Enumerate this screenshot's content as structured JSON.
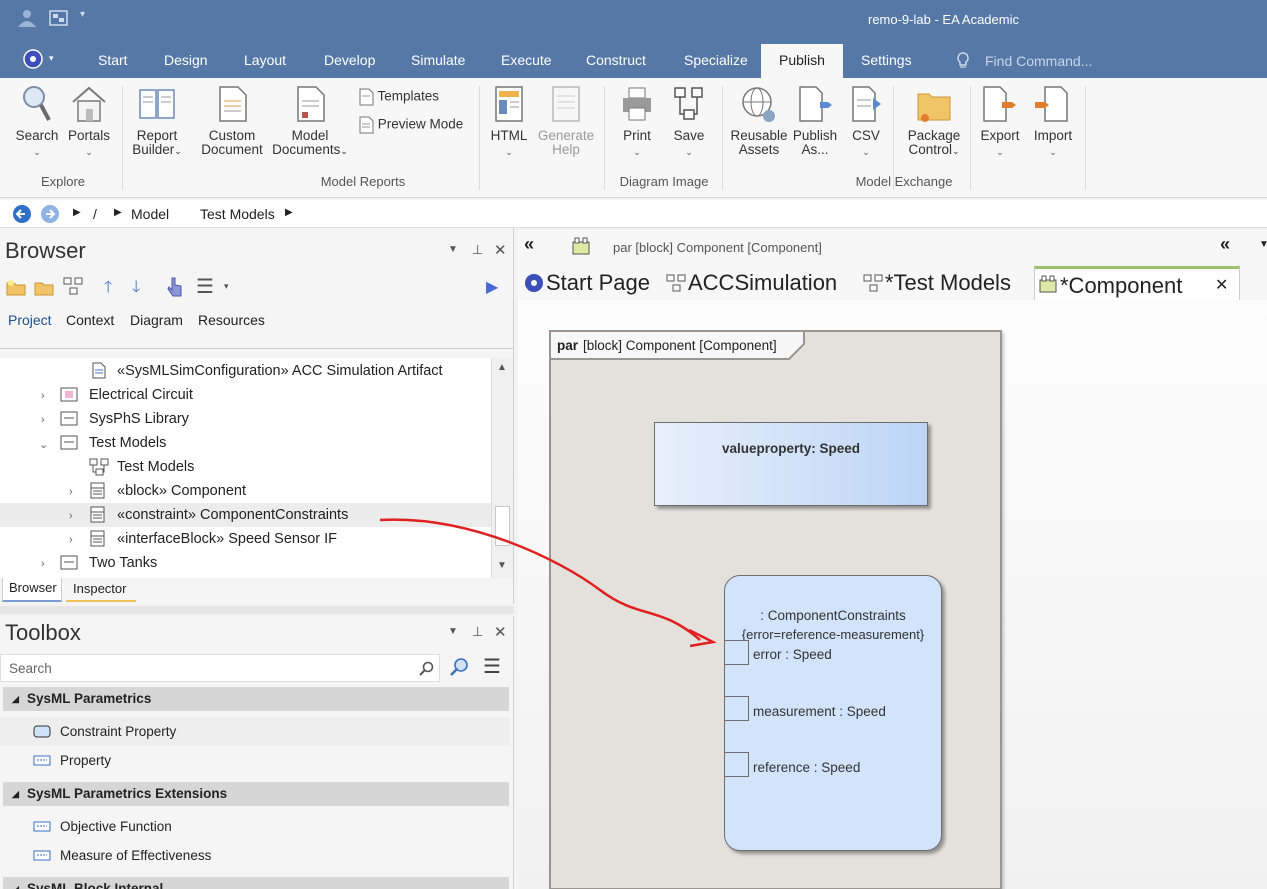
{
  "window": {
    "title": "remo-9-lab - EA Academic"
  },
  "menu": {
    "tabs": [
      "Start",
      "Design",
      "Layout",
      "Develop",
      "Simulate",
      "Execute",
      "Construct",
      "Specialize",
      "Publish",
      "Settings"
    ],
    "active": "Publish",
    "find_placeholder": "Find Command..."
  },
  "ribbon": {
    "search": "Search",
    "portals": "Portals",
    "report_builder_1": "Report",
    "report_builder_2": "Builder",
    "custom_doc_1": "Custom",
    "custom_doc_2": "Document",
    "model_docs_1": "Model",
    "model_docs_2": "Documents",
    "templates": "Templates",
    "preview_mode": "Preview Mode",
    "html": "HTML",
    "generate_help_1": "Generate",
    "generate_help_2": "Help",
    "print": "Print",
    "save": "Save",
    "reusable_1": "Reusable",
    "reusable_2": "Assets",
    "publish_as_1": "Publish",
    "publish_as_2": "As...",
    "csv": "CSV",
    "package_control_1": "Package",
    "package_control_2": "Control",
    "export": "Export",
    "import": "Import",
    "groups": {
      "explore": "Explore",
      "model_reports": "Model Reports",
      "diagram_image": "Diagram Image",
      "model_exchange": "Model Exchange"
    }
  },
  "breadcrumb": {
    "root": "/",
    "item1": "Model",
    "item2": "Test Models"
  },
  "browser": {
    "title": "Browser",
    "tabs": [
      "Project",
      "Context",
      "Diagram",
      "Resources"
    ],
    "tree": [
      "«SysMLSimConfiguration» ACC Simulation Artifact",
      "Electrical Circuit",
      "SysPhS Library",
      "Test Models",
      "Test Models",
      "«block» Component",
      "«constraint» ComponentConstraints",
      "«interfaceBlock» Speed Sensor IF",
      "Two Tanks"
    ],
    "bottom_tabs": [
      "Browser",
      "Inspector"
    ]
  },
  "toolbox": {
    "title": "Toolbox",
    "search_placeholder": "Search",
    "sections": [
      {
        "title": "SysML Parametrics",
        "items": [
          "Constraint Property",
          "Property"
        ]
      },
      {
        "title": "SysML Parametrics Extensions",
        "items": [
          "Objective Function",
          "Measure of Effectiveness"
        ]
      },
      {
        "title": "SysML Block Internal",
        "items": []
      }
    ]
  },
  "diagram": {
    "header": "par [block] Component [Component]",
    "tabs": [
      "Start Page",
      "ACCSimulation",
      "*Test Models",
      "*Component"
    ],
    "frame_kw": "par",
    "frame_label": "[block] Component [Component]",
    "value_property": "valueproperty: Speed",
    "constraint": {
      "name": ": ComponentConstraints",
      "expr": "{error=reference-measurement}",
      "ports": [
        "error : Speed",
        "measurement : Speed",
        "reference : Speed"
      ]
    }
  },
  "colors": {
    "titlebar": "#5578a6",
    "annotation_arrow": "#e02020",
    "element_fill": "#cfe2fb"
  }
}
